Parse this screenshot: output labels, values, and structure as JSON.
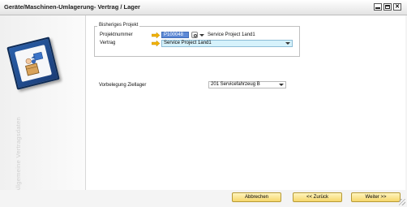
{
  "window": {
    "title": "Geräte/Maschinen-Umlagerung- Vertrag / Lager",
    "close_glyph": "✕"
  },
  "sidebar": {
    "vertical_text": "Allgemeine Vertragsdaten"
  },
  "group": {
    "legend": "Bisheriges Projekt",
    "project_number_label": "Projektnummer",
    "project_number_value": "P100048",
    "project_name_value": "Service Project 1and1",
    "contract_label": "Vertrag",
    "contract_value": "Service Project 1and1"
  },
  "target": {
    "label": "Vorbelegung Ziellager",
    "value": "201 Servicefahrzeug B"
  },
  "buttons": {
    "cancel": "Abbrechen",
    "back": "<< Zurück",
    "next": "Weiter >>"
  }
}
